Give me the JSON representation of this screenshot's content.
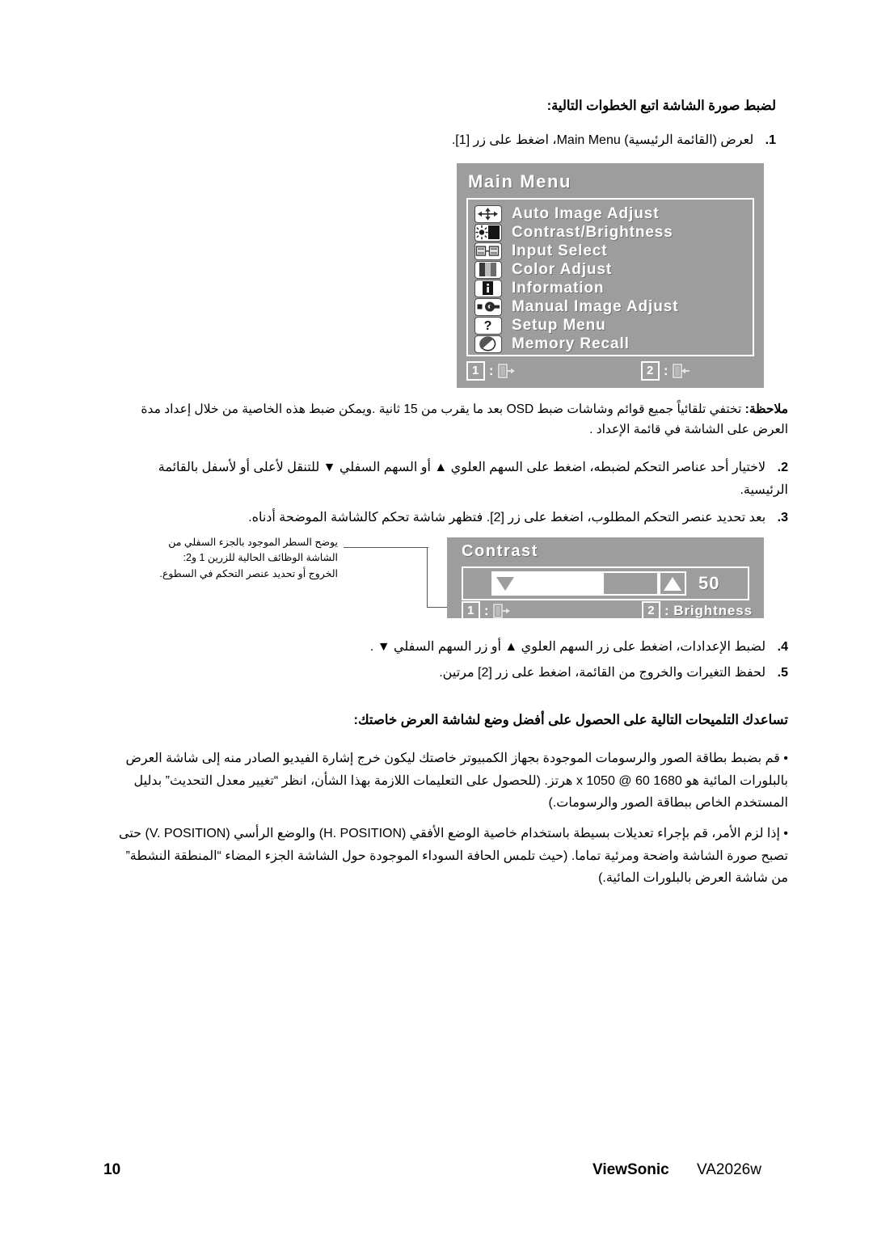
{
  "document": {
    "page_number": "10",
    "brand": "ViewSonic",
    "model": "VA2026w"
  },
  "instructions": {
    "heading": "لضبط صورة الشاشة اتبع الخطوات التالية:",
    "steps": [
      {
        "number": "1.",
        "text": "لعرض (القائمة الرئيسية) Main Menu، اضغط على زر [1]."
      },
      {
        "number": "2.",
        "text": "لاختيار أحد عناصر التحكم لضبطه، اضغط على السهم العلوي ▲ أو السهم السفلي ▼ للتنقل لأعلى أو لأسفل بالقائمة الرئيسية."
      },
      {
        "number": "3.",
        "text": "بعد تحديد عنصر التحكم المطلوب، اضغط على زر [2]. فتظهر شاشة تحكم كالشاشة الموضحة أدناه."
      },
      {
        "number": "4.",
        "text": "لضبط الإعدادات، اضغط على زر السهم العلوي ▲ أو زر السهم السفلي ▼ ."
      },
      {
        "number": "5.",
        "text": "لحفظ التغيرات والخروج من القائمة، اضغط على زر [2] مرتين."
      }
    ],
    "note_label": "ملاحظة:",
    "note_text": "تختفي تلقائياً جميع قوائم وشاشات ضبط OSD بعد ما يقرب من 15 ثانية .ويمكن ضبط هذه الخاصية من خلال إعداد مدة العرض على الشاشة في قائمة الإعداد ."
  },
  "callout": {
    "lines": [
      "يوضح السطر الموجود بالجزء السفلي من",
      "الشاشة الوظائف الحالية للزرين 1 و2:",
      "الخروج أو تحديد عنصر التحكم في السطوع."
    ]
  },
  "main_menu_osd": {
    "title": "Main Menu",
    "items": [
      {
        "icon": "auto-image-adjust-icon",
        "label": "Auto Image Adjust"
      },
      {
        "icon": "contrast-brightness-icon",
        "label": "Contrast/Brightness"
      },
      {
        "icon": "input-select-icon",
        "label": "Input Select"
      },
      {
        "icon": "color-adjust-icon",
        "label": "Color Adjust"
      },
      {
        "icon": "information-icon",
        "label": "Information"
      },
      {
        "icon": "manual-image-adjust-icon",
        "label": "Manual Image Adjust"
      },
      {
        "icon": "setup-menu-icon",
        "label": "Setup Menu"
      },
      {
        "icon": "memory-recall-icon",
        "label": "Memory Recall"
      }
    ],
    "footer": {
      "key1": "1",
      "key1_separator": ":",
      "key1_action_icon": "exit-icon",
      "key2": "2",
      "key2_separator": ":",
      "key2_action_icon": "enter-icon"
    },
    "background_color": "#9d9d9d"
  },
  "contrast_osd": {
    "title": "Contrast",
    "value": "50",
    "value_percent": 50,
    "footer": {
      "key1": "1",
      "key1_separator": ":",
      "key1_action_icon": "exit-icon",
      "key2": "2",
      "key2_separator": ":",
      "key2_label": "Brightness"
    },
    "background_color": "#9d9d9d"
  },
  "tips": {
    "heading": "تساعدك التلميحات التالية على الحصول على أفضل وضع لشاشة العرض خاصتك:",
    "bullets": [
      "قم بضبط بطاقة الصور والرسومات الموجودة بجهاز الكمبيوتر خاصتك ليكون خرج إشارة الفيديو الصادر منه إلى شاشة العرض بالبلورات المائية هو 1680 x 1050 @ 60 هرتز. (للحصول على التعليمات اللازمة بهذا الشأن، انظر “تغيير معدل التحديث” بدليل المستخدم الخاص ببطاقة الصور والرسومات.)",
      "إذا لزم الأمر، قم بإجراء تعديلات بسيطة باستخدام خاصية الوضع الأفقي (H. POSITION) والوضع الرأسي (V. POSITION) حتى تصبح صورة الشاشة واضحة ومرئية تماما. (حيث تلمس الحافة السوداء الموجودة حول الشاشة الجزء المضاء “المنطقة النشطة” من شاشة العرض بالبلورات المائية.)"
    ]
  }
}
